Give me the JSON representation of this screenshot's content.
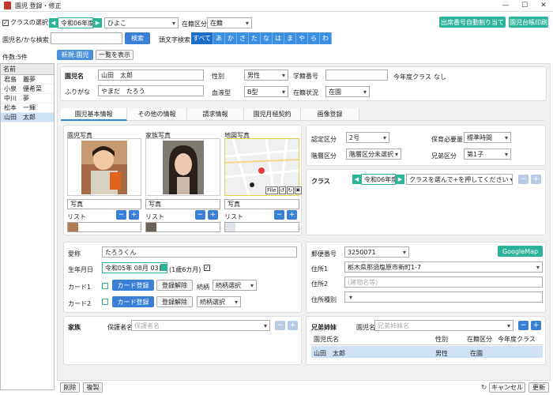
{
  "window": {
    "title": "園児 登録・修正",
    "minimize": "—",
    "maximize": "☐",
    "close": "✕"
  },
  "toolbar": {
    "class_select_label": "クラスの選択",
    "year": "令和06年度",
    "class_value": "ひよこ",
    "enroll_label": "在籍区分",
    "enroll_value": "在籍",
    "auto_number_btn": "出席番号自動割り当て",
    "ledger_print_btn": "園児台帳印刷",
    "search_label": "園児名/かな検索",
    "search_btn": "検索",
    "initial_search_label": "頭文字検索",
    "kana": [
      "すべて",
      "あ",
      "か",
      "さ",
      "た",
      "な",
      "は",
      "ま",
      "や",
      "ら",
      "わ"
    ],
    "count": "件数:5件",
    "new_btn": "新規:園児",
    "list_btn": "一覧を表示"
  },
  "sidebar": {
    "header": "名前",
    "items": [
      "君島　麗夢",
      "小泉　優希菜",
      "中川　夢",
      "松本　一輝",
      "山田　太郎"
    ]
  },
  "child": {
    "name_label": "園児名",
    "name": "山田　太郎",
    "furigana_label": "ふりがな",
    "furigana": "やまだ　たろう",
    "gender_label": "性別",
    "gender": "男性",
    "blood_label": "血液型",
    "blood": "B型",
    "number_label": "学籍番号",
    "number": "",
    "status_label": "在籍状況",
    "status": "在園",
    "this_year_label": "今年度クラス",
    "this_year_value": "なし"
  },
  "tabs": [
    "園児基本情報",
    "その他の情報",
    "請求情報",
    "園児月極契約",
    "画像登録"
  ],
  "photos": {
    "cols": [
      {
        "title": "園児写真",
        "caption": "写真",
        "list_label": "リスト"
      },
      {
        "title": "家族写真",
        "caption": "写真",
        "list_label": "リスト"
      },
      {
        "title": "地図写真",
        "caption": "写真",
        "list_label": "リスト"
      }
    ],
    "file_label": "File"
  },
  "cert": {
    "cert_label": "認定区分",
    "cert_value": "2号",
    "need_label": "保育必要量",
    "need_value": "標準時間",
    "tier_label": "階層区分",
    "tier_value": "階層区分未選択",
    "sibling_label": "兄弟区分",
    "sibling_value": "第1子"
  },
  "class_panel": {
    "label": "クラス",
    "year": "令和06年度",
    "placeholder": "クラスを選んで+を押してください"
  },
  "profile": {
    "nick_label": "愛称",
    "nick": "たろうくん",
    "birth_label": "生年月日",
    "birth": "令和05年 08月 03日",
    "age": "(1歳6カ月)",
    "card1_label": "カード1",
    "card2_label": "カード2",
    "card_reg": "カード登録",
    "card_unreg": "登録解除",
    "continue_label": "続柄",
    "continue_sel": "続柄選択"
  },
  "address": {
    "zip_label": "郵便番号",
    "zip": "3250071",
    "map_btn": "GoogleMap",
    "addr1_label": "住所1",
    "addr1": "栃木県那須塩原市新町1-7",
    "addr2_label": "住所2",
    "addr2_placeholder": "(建物名等)",
    "type_label": "住所種別",
    "type_value": ""
  },
  "family": {
    "label": "家族",
    "guardian_label": "保護者名",
    "guardian_placeholder": "保護者名"
  },
  "siblings": {
    "label": "兄弟姉妹",
    "name_label": "園児名",
    "name_placeholder": "兄弟姉妹名",
    "headers": [
      "園児氏名",
      "性別",
      "在籍区分",
      "今年度クラス"
    ],
    "rows": [
      [
        "山田　太郎",
        "男性",
        "在園",
        ""
      ]
    ]
  },
  "footer": {
    "delete": "削除",
    "copy": "複製",
    "cancel": "キャンセル",
    "update": "更新"
  }
}
